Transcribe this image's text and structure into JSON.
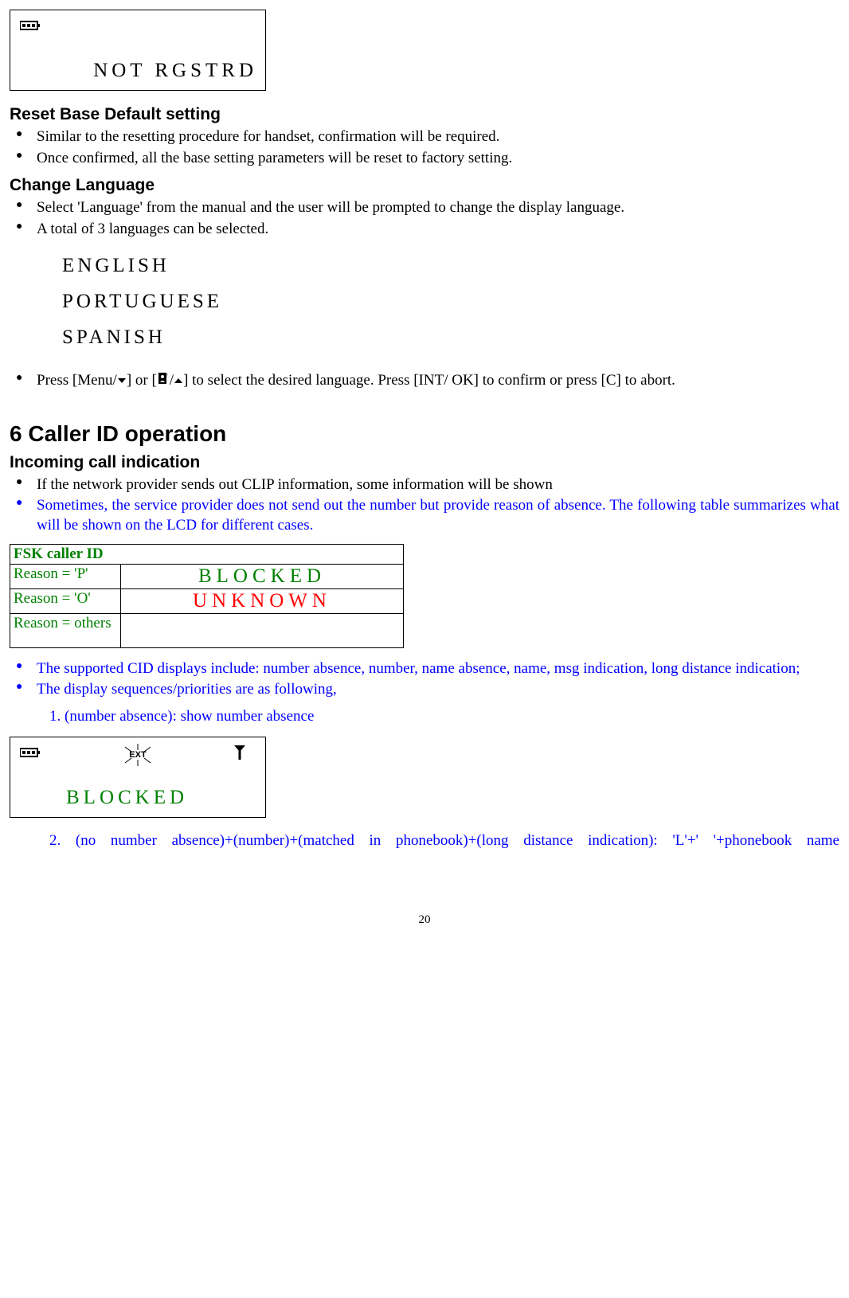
{
  "lcd1": {
    "line2": "NOT  RGSTRD"
  },
  "headings": {
    "reset": "Reset Base Default setting",
    "changeLang": "Change Language",
    "chapter6": "6  Caller ID operation",
    "incoming": "Incoming call indication"
  },
  "reset_bullets": [
    "Similar to the resetting procedure for handset, confirmation will be required.",
    "Once confirmed, all the base setting parameters will be reset to factory setting."
  ],
  "lang_bullets": [
    "Select 'Language' from the manual and the user will be prompted to change the display language.",
    "A total of 3 languages can be selected."
  ],
  "languages": [
    "ENGLISH",
    "PORTUGUESE",
    "SPANISH"
  ],
  "lang_instruction": {
    "pre": "Press [Menu/",
    "mid1": "] or [",
    "mid2": "/",
    "mid3": "]",
    "post": " to select the desired language. Press [INT/ OK] to confirm or press [C] to abort."
  },
  "incoming_bullets": {
    "b1": "If the network provider sends out CLIP information, some information will be shown",
    "b2": "Sometimes, the service provider does not send out the number but provide reason of absence.   The following table summarizes what will be shown on the LCD for different cases."
  },
  "fsk_table": {
    "header": "FSK caller ID",
    "rows": [
      {
        "reason": "Reason = 'P'",
        "disp": "BLOCKED",
        "color": "c-green"
      },
      {
        "reason": "Reason = 'O'",
        "disp": "UNKNOWN",
        "color": "c-red"
      },
      {
        "reason": "Reason = others",
        "disp": "",
        "color": ""
      }
    ]
  },
  "cid_bullets": [
    "The supported CID displays include: number absence, number, name absence, name, msg indication, long distance indication;",
    "The display sequences/priorities are as following,"
  ],
  "seq1": "1.   (number absence): show number absence",
  "lcd2": {
    "ext": "EXT",
    "line2": "BLOCKED"
  },
  "seq2": "2. (no number absence)+(number)+(matched in phonebook)+(long distance indication): 'L'+' '+phonebook name",
  "page": "20"
}
